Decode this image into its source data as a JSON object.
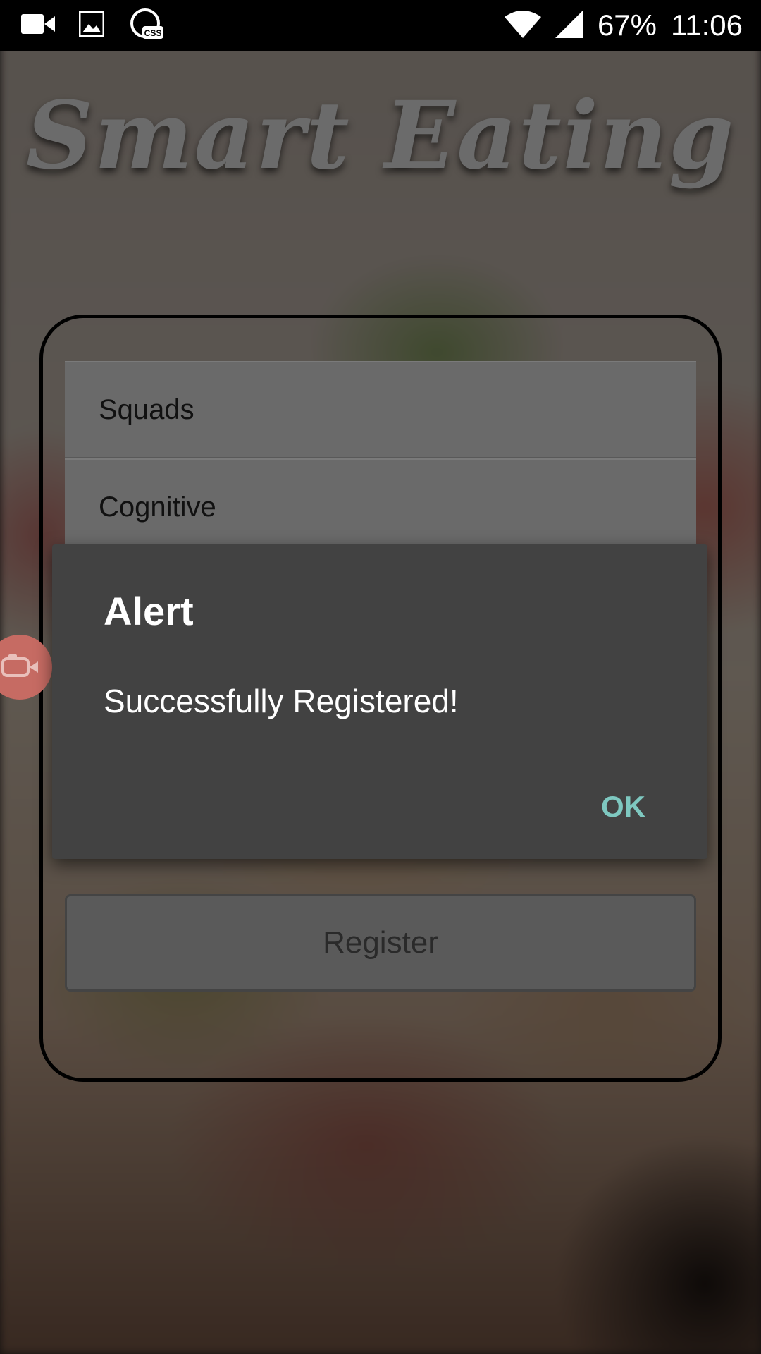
{
  "status_bar": {
    "battery": "67%",
    "time": "11:06",
    "icons": [
      "video-camera-icon",
      "image-icon",
      "css-icon",
      "wifi-icon",
      "signal-icon"
    ]
  },
  "app": {
    "logo": "Smart Eating"
  },
  "form": {
    "items": [
      {
        "label": "Squads"
      },
      {
        "label": "Cognitive"
      }
    ],
    "register_label": "Register"
  },
  "dialog": {
    "title": "Alert",
    "message": "Successfully Registered!",
    "ok_label": "OK"
  },
  "colors": {
    "dialog_bg": "#424242",
    "ok_accent": "#7ec8c0"
  }
}
